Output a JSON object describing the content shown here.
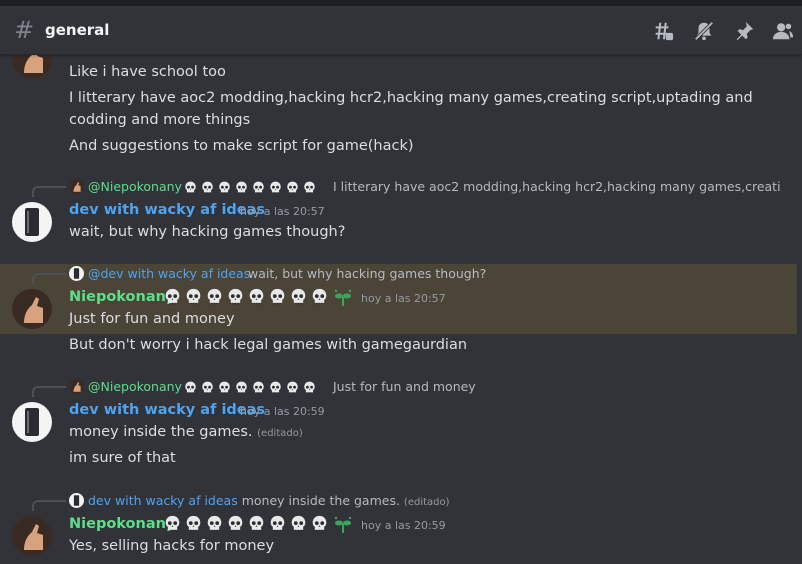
{
  "channel": {
    "name": "general"
  },
  "header_icons": [
    "threads-icon",
    "mute-icon",
    "pin-icon",
    "member-list-icon"
  ],
  "messages": {
    "m1": {
      "lines": [
        "Like i have school too",
        "I litterary have aoc2 modding,hacking hcr2,hacking many games,creating script,uptading and codding and more things",
        "And suggestions to make script for game(hack)"
      ]
    },
    "m2": {
      "reply_name": "@Niepokonany",
      "reply_text": "I litterary have aoc2 modding,hacking hcr2,hacking many games,creati",
      "author": "dev with wacky af ideas",
      "time": "hoy a las 20:57",
      "lines": [
        "wait, but why hacking games though?"
      ]
    },
    "m3": {
      "reply_name": "@dev with wacky af ideas",
      "reply_text": "wait, but why hacking games though?",
      "author": "Niepokonany",
      "time": "hoy a las 20:57",
      "lines": [
        "Just for fun and money",
        "But don't worry i hack legal games with gamegaurdian"
      ]
    },
    "m4": {
      "reply_name": "@Niepokonany",
      "reply_text": "Just for fun and money",
      "author": "dev with wacky af ideas",
      "time": "hoy a las 20:59",
      "lines": [
        "money inside the games.",
        "im sure of that"
      ],
      "edited": "(editado)"
    },
    "m5": {
      "reply_name": "dev with wacky af ideas",
      "reply_text": "money inside the games.",
      "reply_edited": "(editado)",
      "author": "Niepokonany",
      "time": "hoy a las 20:59",
      "lines": [
        "Yes, selling hacks for money"
      ]
    }
  },
  "colors": {
    "background": "#313338",
    "dev_name": "#4ea3f2",
    "niepokonany_name": "#5edd8b",
    "mention_highlight": "#4a4537"
  }
}
